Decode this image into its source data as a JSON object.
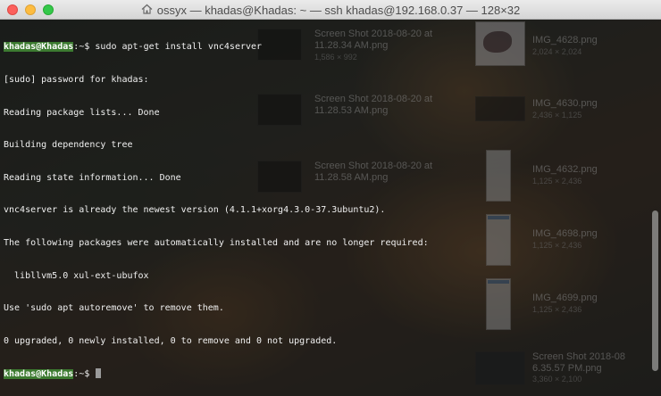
{
  "window": {
    "title": "ossyx — khadas@Khadas: ~ — ssh khadas@192.168.0.37 — 128×32",
    "home_icon": "home-icon"
  },
  "terminal": {
    "prompt_user": "khadas@Khadas",
    "prompt_sep": ":",
    "prompt_path": "~",
    "prompt_symbol": "$",
    "command": "sudo apt-get install vnc4server",
    "output": [
      "[sudo] password for khadas:",
      "Reading package lists... Done",
      "Building dependency tree",
      "Reading state information... Done",
      "vnc4server is already the newest version (4.1.1+xorg4.3.0-37.3ubuntu2).",
      "The following packages were automatically installed and are no longer required:",
      "  libllvm5.0 xul-ext-ubufox",
      "Use 'sudo apt autoremove' to remove them.",
      "0 upgraded, 0 newly installed, 0 to remove and 0 not upgraded."
    ]
  },
  "desktop": {
    "files": [
      {
        "name_line1": "Screen Shot 2018-08-20 at",
        "name_line2": "11.28.34 AM.png",
        "size": "1,586 × 992"
      },
      {
        "name_line1": "Screen Shot 2018-08-20 at",
        "name_line2": "11.28.53 AM.png",
        "size": ""
      },
      {
        "name_line1": "Screen Shot 2018-08-20 at",
        "name_line2": "11.28.58 AM.png",
        "size": ""
      },
      {
        "name_line1": "IMG_4628.png",
        "name_line2": "",
        "size": "2,024 × 2,024"
      },
      {
        "name_line1": "IMG_4630.png",
        "name_line2": "",
        "size": "2,436 × 1,125"
      },
      {
        "name_line1": "IMG_4632.png",
        "name_line2": "",
        "size": "1,125 × 2,436"
      },
      {
        "name_line1": "IMG_4698.png",
        "name_line2": "",
        "size": "1,125 × 2,436"
      },
      {
        "name_line1": "IMG_4699.png",
        "name_line2": "",
        "size": "1,125 × 2,436"
      },
      {
        "name_line1": "Screen Shot 2018-08",
        "name_line2": "6.35.57 PM.png",
        "size": "3,360 × 2,100"
      }
    ]
  }
}
